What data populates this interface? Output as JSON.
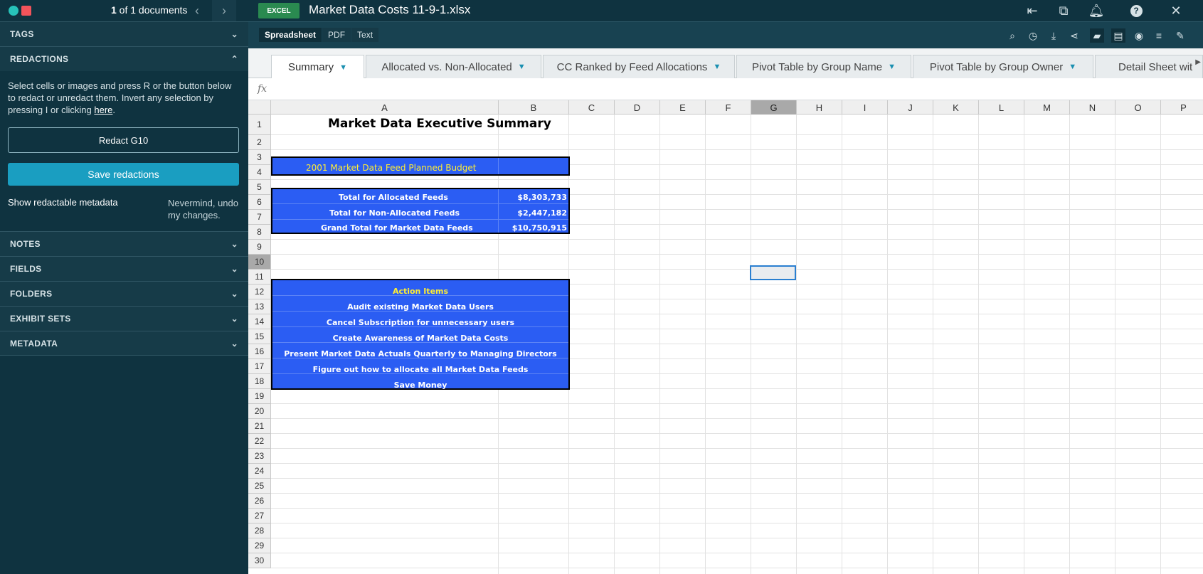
{
  "sidebar": {
    "doc_counter_bold": "1",
    "doc_counter_rest": " of 1 documents",
    "sections": {
      "tags": "TAGS",
      "redactions": "REDACTIONS",
      "notes": "NOTES",
      "fields": "FIELDS",
      "folders": "FOLDERS",
      "exhibit_sets": "EXHIBIT SETS",
      "metadata": "METADATA"
    },
    "redactions": {
      "description": "Select cells or images and press R or the button below to redact or unredact them. Invert any selection by pressing I or clicking ",
      "here_link": "here",
      "period": ".",
      "redact_button": "Redact G10",
      "save_button": "Save redactions",
      "show_metadata": "Show redactable metadata",
      "undo": "Nevermind, undo my changes."
    }
  },
  "header": {
    "badge": "EXCEL",
    "file_title": "Market Data Costs 11-9-1.xlsx"
  },
  "toolbar": {
    "view_tabs": [
      "Spreadsheet",
      "PDF",
      "Text"
    ]
  },
  "sheet_tabs": [
    "Summary",
    "Allocated vs. Non-Allocated",
    "CC Ranked by Feed Allocations",
    "Pivot Table by Group Name",
    "Pivot Table by Group Owner",
    "Detail Sheet wit"
  ],
  "formula_bar": {
    "fx": "fx"
  },
  "columns": [
    "A",
    "B",
    "C",
    "D",
    "E",
    "F",
    "G",
    "H",
    "I",
    "J",
    "K",
    "L",
    "M",
    "N",
    "O",
    "P"
  ],
  "rows": [
    "1",
    "2",
    "3",
    "4",
    "5",
    "6",
    "7",
    "8",
    "9",
    "10",
    "11",
    "12",
    "13",
    "14",
    "15",
    "16",
    "17",
    "18",
    "19",
    "20",
    "21",
    "22",
    "23",
    "24",
    "25",
    "26",
    "27",
    "28",
    "29",
    "30"
  ],
  "sheet": {
    "title": "Market Data Executive Summary",
    "budget_header": "2001 Market Data Feed Planned Budget",
    "totals": [
      {
        "label": "Total for Allocated Feeds",
        "value": "$8,303,733"
      },
      {
        "label": "Total for Non-Allocated Feeds",
        "value": "$2,447,182"
      },
      {
        "label": "Grand Total for Market Data Feeds",
        "value": "$10,750,915"
      }
    ],
    "action_header": "Action Items",
    "action_items": [
      "Audit existing Market Data Users",
      "Cancel Subscription for unnecessary users",
      "Create Awareness of Market Data Costs",
      "Present Market Data Actuals Quarterly to Managing Directors",
      "Figure out how to allocate all Market Data Feeds",
      "Save Money"
    ]
  },
  "colors": {
    "sidebar_bg": "#0f3340",
    "accent": "#1a9ec1",
    "cell_blue": "#2b5df3",
    "cell_yellow": "#ffee33",
    "excel_green": "#2a8a50"
  }
}
